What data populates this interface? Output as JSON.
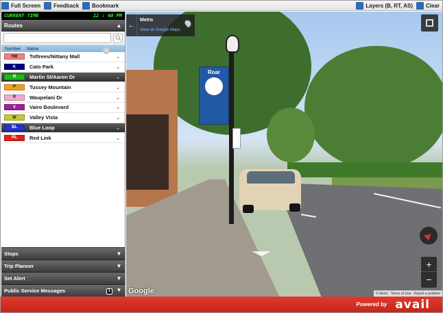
{
  "toolbar": {
    "full_screen": "Full Screen",
    "feedback": "Feedback",
    "bookmark": "Bookmark",
    "layers": "Layers (B, RT, AS)",
    "clear": "Clear"
  },
  "clock": {
    "label": "CURRENT TIME",
    "time": "12 : 40 PM"
  },
  "routes_panel": {
    "title": "Routes",
    "search": {
      "value": "",
      "placeholder": ""
    },
    "col_number": "Number",
    "col_name": "Name",
    "items": [
      {
        "code": "HM",
        "name": "Toftrees/Nittany Mall",
        "color": "#f08080",
        "text_color": "#1a1a1a",
        "selected": false
      },
      {
        "code": "K",
        "name": "Cato Park",
        "color": "#000080",
        "text_color": "#ffffff",
        "selected": false
      },
      {
        "code": "N",
        "name": "Martin St/Aaron Dr",
        "color": "#1db91d",
        "text_color": "#ffffff",
        "selected": true
      },
      {
        "code": "P",
        "name": "Tussey Mountain",
        "color": "#f0a020",
        "text_color": "#1a1a1a",
        "selected": false
      },
      {
        "code": "R",
        "name": "Waupelani Dr",
        "color": "#f4a8d0",
        "text_color": "#1a1a1a",
        "selected": false
      },
      {
        "code": "V",
        "name": "Vairo Boulevard",
        "color": "#a020a0",
        "text_color": "#ffffff",
        "selected": false
      },
      {
        "code": "W",
        "name": "Valley Vista",
        "color": "#c8c832",
        "text_color": "#1a1a1a",
        "selected": false
      },
      {
        "code": "BL",
        "name": "Blue Loop",
        "color": "#1e32e0",
        "text_color": "#ffffff",
        "selected": true
      },
      {
        "code": "RL",
        "name": "Red Link",
        "color": "#e01e1e",
        "text_color": "#ffffff",
        "selected": false
      }
    ]
  },
  "bottom_panels": {
    "stops": "Stops",
    "trip_planner": "Trip Planner",
    "set_alert": "Set Alert",
    "psm": "Public Service Messages",
    "psm_count": "1"
  },
  "street_view": {
    "location": "Metro",
    "link": "View on Google Maps",
    "banner_text": "Roar",
    "google": "Google",
    "terms": [
      "© Metro",
      "Terms of Use",
      "Report a problem"
    ]
  },
  "footer": {
    "powered_by": "Powered by",
    "brand": "avail"
  },
  "colors": {
    "footer": "#d32f2f",
    "toolbar_icon": "#2d6bb3",
    "clock_text": "#2cff2c"
  }
}
